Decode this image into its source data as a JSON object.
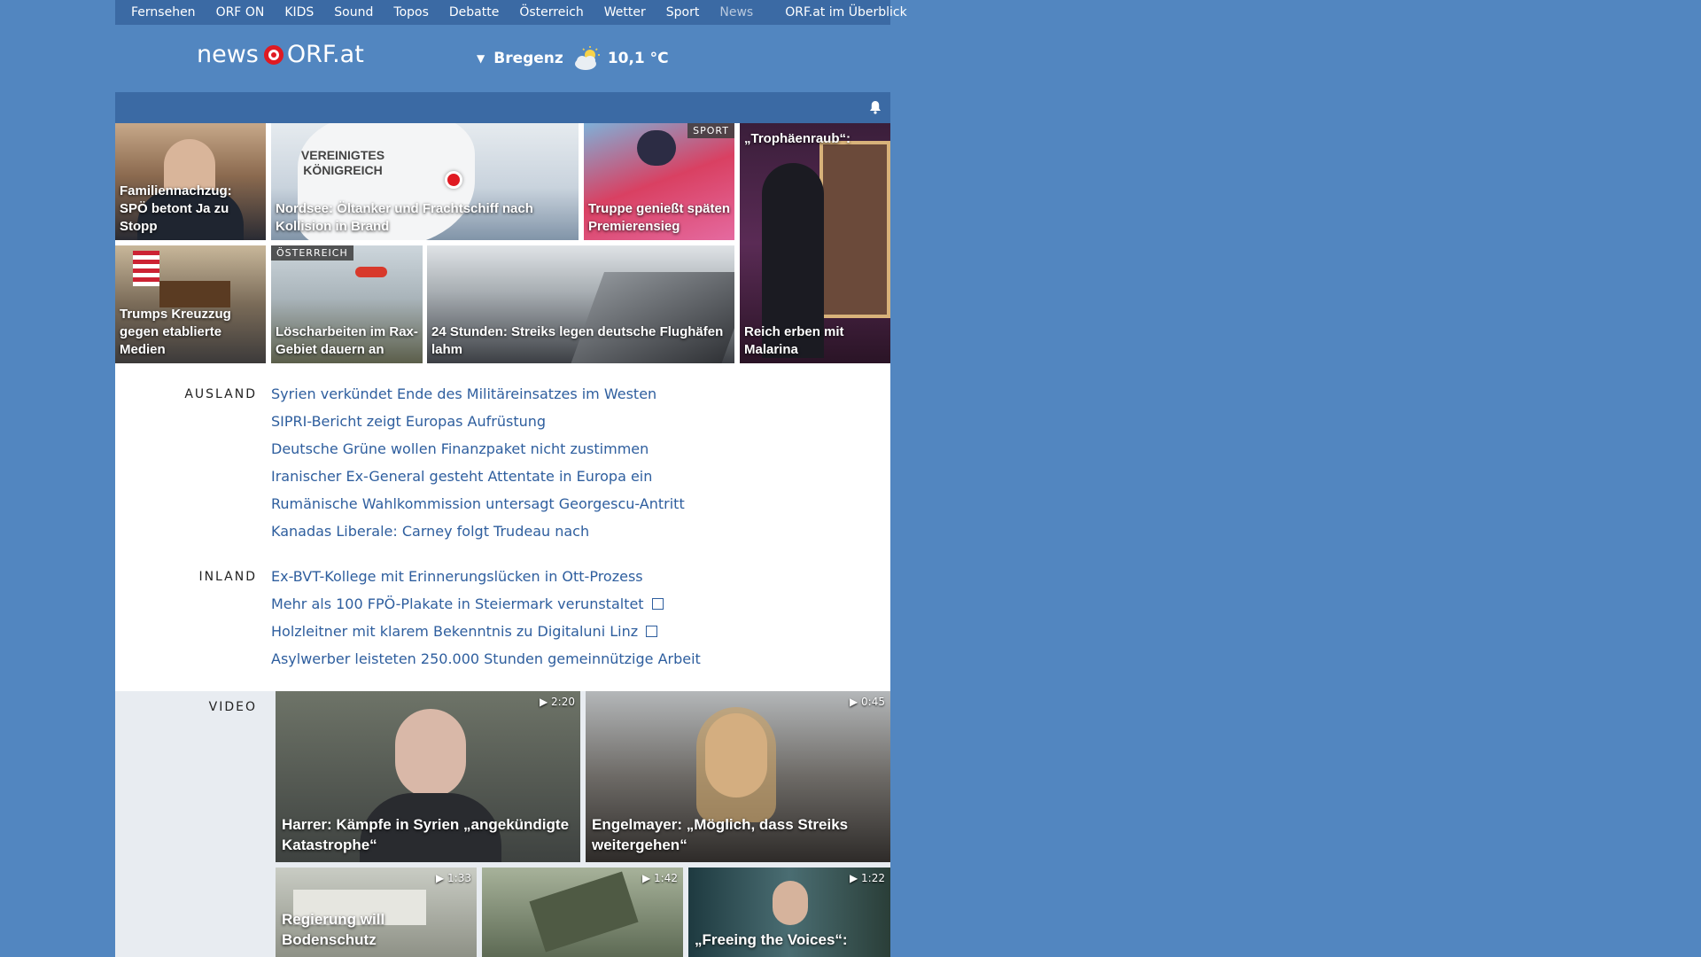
{
  "topnav": {
    "items": [
      "Fernsehen",
      "ORF ON",
      "KIDS",
      "Sound",
      "Topos",
      "Debatte",
      "Österreich",
      "Wetter",
      "Sport",
      "News"
    ],
    "overview": "ORF.at im Überblick"
  },
  "header": {
    "logo_news": "news",
    "logo_orf": "ORF.at",
    "location": "Bregenz",
    "temperature": "10,1 °C"
  },
  "tiles": [
    {
      "caption": "Familiennachzug: SPÖ betont Ja zu Stopp"
    },
    {
      "caption": "Nordsee: Öltanker und Frachtschiff nach Kollision in Brand",
      "map_label": "VEREINIGTES KÖNIGREICH"
    },
    {
      "caption": "Truppe genießt späten Premierensieg",
      "tag": "SPORT"
    },
    {
      "caption_top": "„Trophäenraub“:",
      "caption": "Reich erben mit Malarina"
    },
    {
      "caption": "Trumps Kreuzzug gegen etablierte Medien"
    },
    {
      "caption": "Löscharbeiten im Rax-Gebiet dauern an",
      "tag": "ÖSTERREICH"
    },
    {
      "caption": "24 Stunden: Streiks legen deutsche Flughäfen lahm"
    }
  ],
  "ausland": {
    "label": "AUSLAND",
    "items": [
      "Syrien verkündet Ende des Militäreinsatzes im Westen",
      "SIPRI-Bericht zeigt Europas Aufrüstung",
      "Deutsche Grüne wollen Finanzpaket nicht zustimmen",
      "Iranischer Ex-General gesteht Attentate in Europa ein",
      "Rumänische Wahlkommission untersagt Georgescu-Antritt",
      "Kanadas Liberale: Carney folgt Trudeau nach"
    ]
  },
  "inland": {
    "label": "INLAND",
    "items": [
      "Ex-BVT-Kollege mit Erinnerungslücken in Ott-Prozess",
      "Mehr als 100 FPÖ-Plakate in Steiermark verunstaltet",
      "Holzleitner mit klarem Bekenntnis zu Digitaluni Linz",
      "Asylwerber leisteten 250.000 Stunden gemeinnützige Arbeit"
    ]
  },
  "video": {
    "label": "VIDEO",
    "items": [
      {
        "caption": "Harrer: Kämpfe in Syrien „angekündigte Katastrophe“",
        "duration": "2:20"
      },
      {
        "caption": "Engelmayer: „Möglich, dass Streiks weitergehen“",
        "duration": "0:45"
      },
      {
        "caption": "Regierung will Bodenschutz",
        "duration": "1:33"
      },
      {
        "caption": "",
        "duration": "1:42"
      },
      {
        "caption": "„Freeing the Voices“:",
        "duration": "1:22"
      }
    ]
  },
  "colors": {
    "background": "#5286c0",
    "nav_bar": "#3b6aa4",
    "link": "#2e5e9e",
    "orf_red": "#e01a22"
  }
}
